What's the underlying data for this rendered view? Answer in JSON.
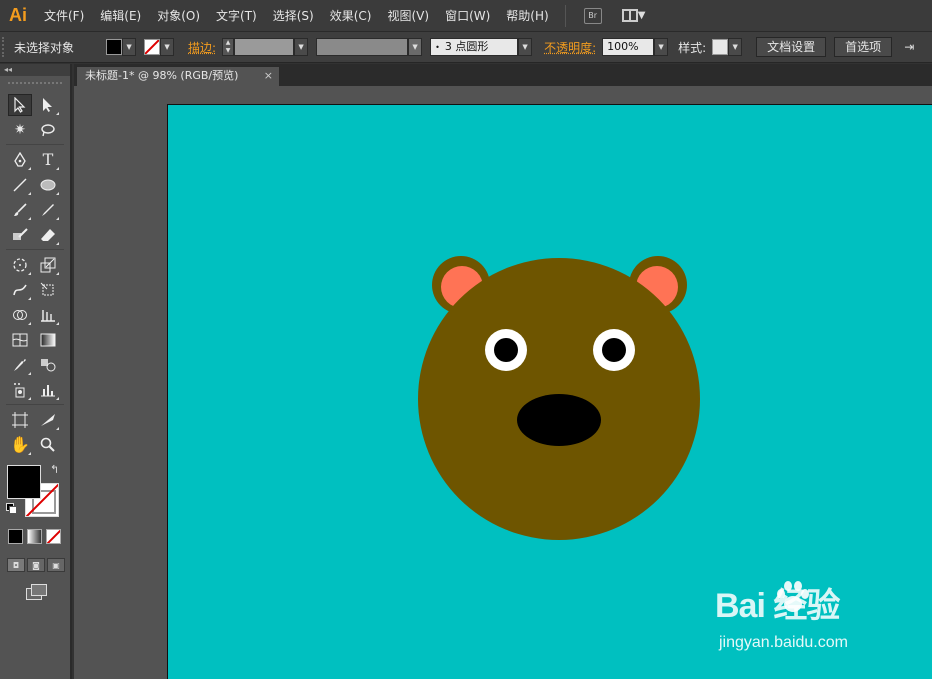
{
  "app": {
    "logo": "Ai"
  },
  "menu": [
    {
      "label": "文件(F)"
    },
    {
      "label": "编辑(E)"
    },
    {
      "label": "对象(O)"
    },
    {
      "label": "文字(T)"
    },
    {
      "label": "选择(S)"
    },
    {
      "label": "效果(C)"
    },
    {
      "label": "视图(V)"
    },
    {
      "label": "窗口(W)"
    },
    {
      "label": "帮助(H)"
    }
  ],
  "menu_extras": {
    "bridge_label": "Br"
  },
  "control_bar": {
    "selection_status": "未选择对象",
    "stroke_label": "描边:",
    "brush_value": "3 点圆形",
    "opacity_label": "不透明度:",
    "opacity_value": "100%",
    "style_label": "样式:",
    "doc_setup_button": "文档设置",
    "preferences_button": "首选项"
  },
  "document_tab": {
    "title": "未标题-1* @ 98% (RGB/预览)",
    "close": "×"
  },
  "tools_panel": {
    "header": "◂◂"
  },
  "colors": {
    "background": "#00C0C0",
    "bear_head": "#6E5500",
    "inner_ear": "#FF7355",
    "eye_white": "#FFFFFF",
    "pupil": "#000000",
    "nose": "#000000",
    "fill": "#000000",
    "stroke": "none",
    "accent": "#F39C1E"
  },
  "watermark": {
    "logo": "Bai  经验",
    "logo_icon": "paw-icon",
    "subtitle": "jingyan.baidu.com"
  }
}
